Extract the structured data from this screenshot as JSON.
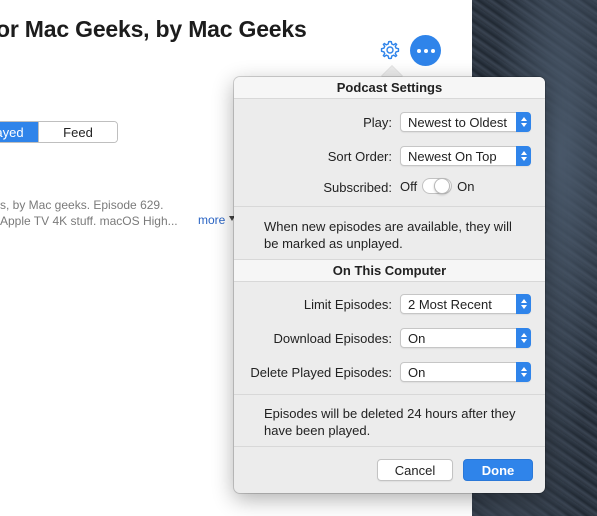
{
  "header": {
    "title": "or Mac Geeks, by Mac Geeks",
    "settings_icon": "gear-icon",
    "more_icon": "ellipsis-icon"
  },
  "segments": {
    "played": "ayed",
    "feed": "Feed"
  },
  "episode": {
    "desc_line1": "s, by Mac geeks. Episode 629.",
    "desc_line2": "Apple TV 4K stuff. macOS High...",
    "more": "more"
  },
  "popover": {
    "title": "Podcast Settings",
    "play_label": "Play:",
    "play_value": "Newest to Oldest",
    "sort_label": "Sort Order:",
    "sort_value": "Newest On Top",
    "subscribed_label": "Subscribed:",
    "off_label": "Off",
    "on_label": "On",
    "subscribed_on": true,
    "unplayed_note": "When new episodes are available, they will be marked as unplayed.",
    "computer_title": "On This Computer",
    "limit_label": "Limit Episodes:",
    "limit_value": "2 Most Recent",
    "download_label": "Download Episodes:",
    "download_value": "On",
    "delete_label": "Delete Played Episodes:",
    "delete_value": "On",
    "delete_note": "Episodes will be deleted 24 hours after they have been played.",
    "cancel_label": "Cancel",
    "done_label": "Done"
  },
  "colors": {
    "accent": "#2f84ea",
    "popover_bg": "#ececec"
  }
}
